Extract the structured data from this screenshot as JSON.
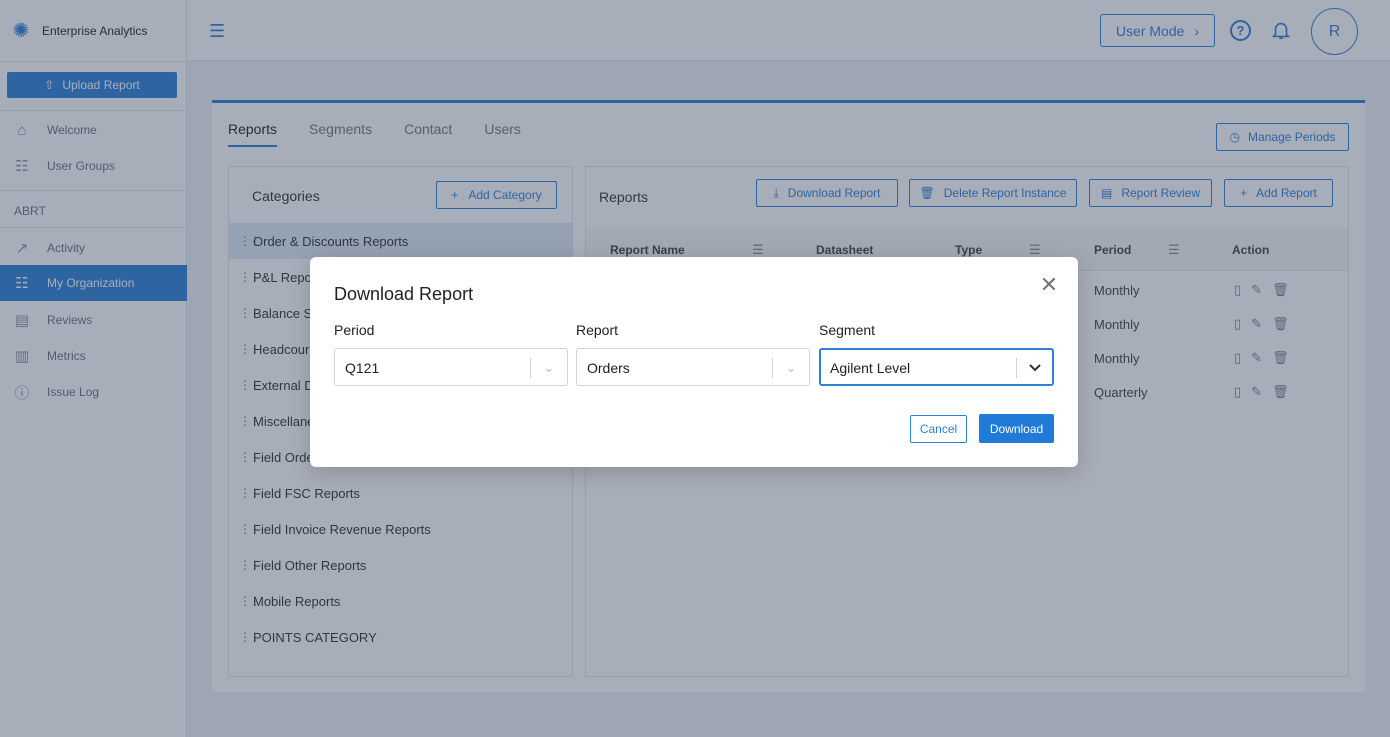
{
  "app": {
    "title": "Enterprise Analytics"
  },
  "sidebar": {
    "upload_label": "Upload Report",
    "items_top": [
      {
        "label": "Welcome",
        "icon": "home-icon"
      },
      {
        "label": "User Groups",
        "icon": "users-icon"
      }
    ],
    "section_label": "ABRT",
    "items": [
      {
        "label": "Activity",
        "icon": "activity-icon"
      },
      {
        "label": "My Organization",
        "icon": "organization-icon"
      },
      {
        "label": "Reviews",
        "icon": "clipboard-icon"
      },
      {
        "label": "Metrics",
        "icon": "bar-chart-icon"
      },
      {
        "label": "Issue Log",
        "icon": "info-icon"
      }
    ]
  },
  "header": {
    "user_mode_label": "User Mode",
    "avatar_initial": "R"
  },
  "tabs": [
    "Reports",
    "Segments",
    "Contact",
    "Users"
  ],
  "manage_periods_label": "Manage Periods",
  "categories": {
    "title": "Categories",
    "add_label": "Add Category",
    "items": [
      "Order & Discounts Reports",
      "P&L Repo",
      "Balance S",
      "Headcour",
      "External D",
      "Miscellane",
      "Field Orde",
      "Field FSC Reports",
      "Field Invoice Revenue Reports",
      "Field Other Reports",
      "Mobile Reports",
      "POINTS CATEGORY"
    ]
  },
  "reports": {
    "title": "Reports",
    "buttons": {
      "download": "Download Report",
      "delete": "Delete Report Instance",
      "review": "Report Review",
      "add": "Add Report"
    },
    "columns": {
      "name": "Report Name",
      "datasheet": "Datasheet",
      "type": "Type",
      "period": "Period",
      "action": "Action"
    },
    "rows": [
      {
        "period": "Monthly"
      },
      {
        "period": "Monthly"
      },
      {
        "period": "Monthly"
      },
      {
        "period": "Quarterly"
      }
    ]
  },
  "modal": {
    "title": "Download Report",
    "period_label": "Period",
    "period_value": "Q121",
    "report_label": "Report",
    "report_value": "Orders",
    "segment_label": "Segment",
    "segment_value": "Agilent Level",
    "cancel_label": "Cancel",
    "download_label": "Download"
  },
  "colors": {
    "accent": "#2f80d8",
    "overlay": "#2f3e59"
  }
}
